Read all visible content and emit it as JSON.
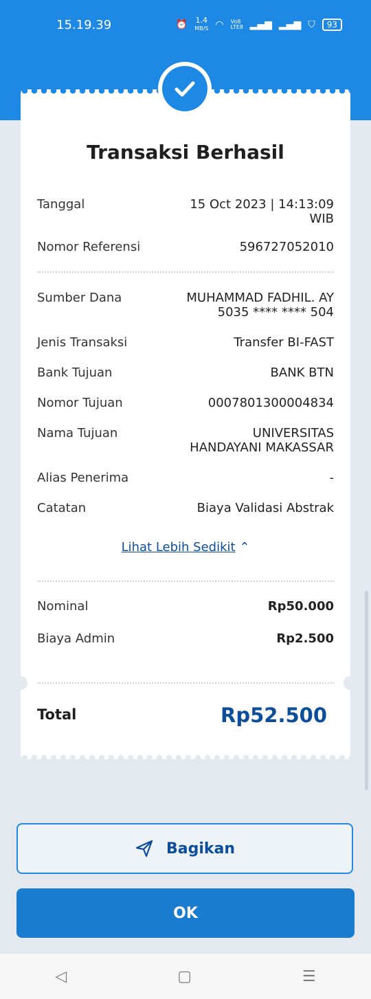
{
  "status": {
    "time": "15.19.39",
    "battery": "93",
    "net_speed": "1.4",
    "net_unit": "MB/S",
    "volte": "Vo8 LTE8"
  },
  "receipt": {
    "title": "Transaksi Berhasil",
    "tanggal_label": "Tanggal",
    "tanggal_value": "15 Oct 2023 | 14:13:09",
    "tanggal_tz": "WIB",
    "ref_label": "Nomor Referensi",
    "ref_value": "596727052010",
    "sumber_label": "Sumber Dana",
    "sumber_name": "MUHAMMAD FADHIL. AY",
    "sumber_account": "5035 **** **** 504",
    "jenis_label": "Jenis Transaksi",
    "jenis_value": "Transfer BI-FAST",
    "bank_label": "Bank Tujuan",
    "bank_value": "BANK BTN",
    "nomor_label": "Nomor Tujuan",
    "nomor_value": "0007801300004834",
    "nama_label": "Nama Tujuan",
    "nama_line1": "UNIVERSITAS",
    "nama_line2": "HANDAYANI MAKASSAR",
    "alias_label": "Alias Penerima",
    "alias_value": "-",
    "catatan_label": "Catatan",
    "catatan_value": "Biaya Validasi Abstrak",
    "less_link": "Lihat Lebih Sedikit",
    "nominal_label": "Nominal",
    "nominal_value": "Rp50.000",
    "admin_label": "Biaya Admin",
    "admin_value": "Rp2.500",
    "total_label": "Total",
    "total_value": "Rp52.500"
  },
  "buttons": {
    "share": "Bagikan",
    "ok": "OK"
  },
  "colors": {
    "primary": "#1e88e5",
    "dark_blue": "#0d4e9a"
  }
}
